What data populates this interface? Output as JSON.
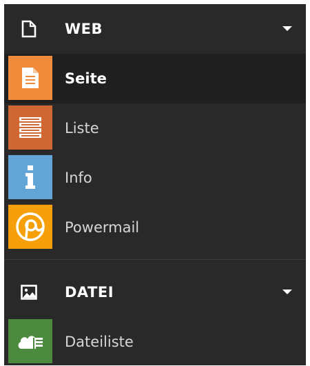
{
  "colors": {
    "sidebar_bg": "#292929",
    "active_bg": "#1f1f1f",
    "seite": "#f18b3c",
    "liste": "#cf6733",
    "info": "#64a5d8",
    "powermail": "#f5a00a",
    "dateiliste": "#4b8a3f"
  },
  "groups": [
    {
      "title": "WEB",
      "icon": "document-icon",
      "modules": [
        {
          "label": "Seite",
          "icon": "page-icon",
          "active": true
        },
        {
          "label": "Liste",
          "icon": "list-icon",
          "active": false
        },
        {
          "label": "Info",
          "icon": "info-icon",
          "active": false
        },
        {
          "label": "Powermail",
          "icon": "powermail-icon",
          "active": false
        }
      ]
    },
    {
      "title": "DATEI",
      "icon": "image-icon",
      "modules": [
        {
          "label": "Dateiliste",
          "icon": "cloud-list-icon",
          "active": false
        }
      ]
    }
  ]
}
